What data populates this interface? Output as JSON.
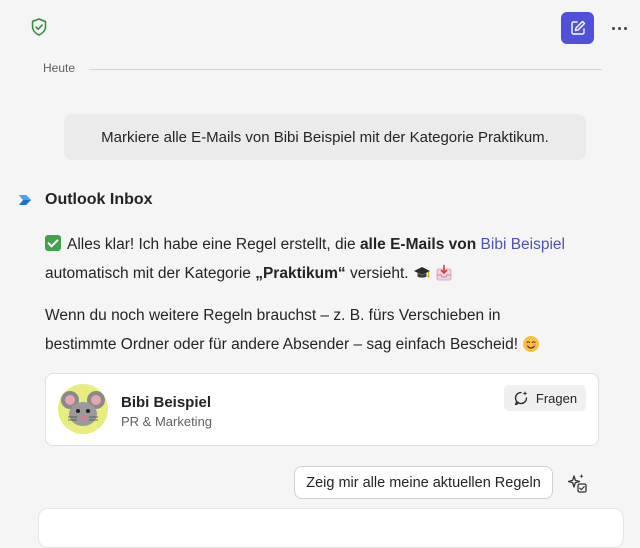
{
  "header": {
    "shield_icon": "shield-check-icon",
    "compose_icon": "compose-icon",
    "more_icon": "more-horizontal-icon",
    "accent_color": "#4f52d9"
  },
  "date_divider": "Heute",
  "user_message": "Markiere alle E-Mails von Bibi Beispiel mit der Kategorie Praktikum.",
  "bot": {
    "name": "Outlook Inbox",
    "logo_icon": "outlook-logo-icon",
    "msg1_a": "Alles klar! Ich habe eine Regel erstellt, die ",
    "msg1_b": "alle E-Mails von",
    "msg1_c": " ",
    "msg1_link": "Bibi Beispiel",
    "msg2_a": "automatisch mit der Kategorie ",
    "msg2_b": "„Praktikum“",
    "msg2_c": " versieht. ",
    "msg3": "Wenn du noch weitere Regeln brauchst – z. B. fürs Verschieben in",
    "msg4": "bestimmte Ordner oder für andere Absender – sag einfach Bescheid! ",
    "emojis": [
      "check-mark-icon",
      "graduation-cap-icon",
      "inbox-tray-icon",
      "smiling-face-icon"
    ]
  },
  "contact_card": {
    "name": "Bibi Beispiel",
    "role": "PR & Marketing",
    "ask_label": "Fragen",
    "ask_icon": "chat-sparkle-icon",
    "avatar_color": "#e8ed7f"
  },
  "suggestion": {
    "label": "Zeig mir alle meine aktuellen Regeln",
    "sparkle_icon": "sparkle-icon"
  }
}
